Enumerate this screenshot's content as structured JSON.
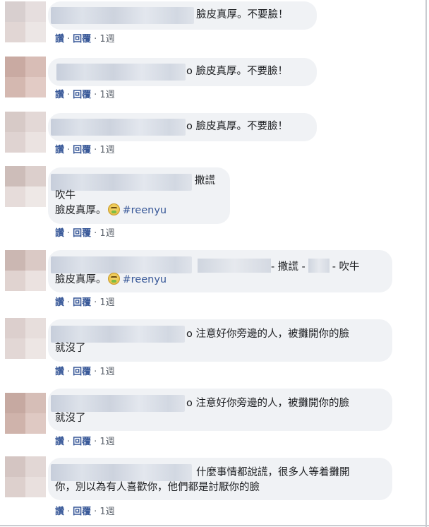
{
  "actions": {
    "like": "讚",
    "reply": "回覆",
    "separator": "·",
    "time": "1週"
  },
  "comments": [
    {
      "lines": [
        "臉皮真厚。不要臉！"
      ]
    },
    {
      "lines": [
        "o 臉皮真厚。不要臉！"
      ]
    },
    {
      "lines": [
        "o 臉皮真厚。不要臉！"
      ]
    },
    {
      "lines": [
        "撒謊",
        "吹牛",
        "臉皮真厚。"
      ],
      "hashtag": "#reenyu"
    },
    {
      "lines": [
        "- 撒謊 -",
        "- 吹牛",
        "臉皮真厚。"
      ],
      "hashtag": "#reenyu"
    },
    {
      "lines": [
        "o 注意好你旁邊的人，被攤開你的臉",
        "就沒了"
      ]
    },
    {
      "lines": [
        "o 注意好你旁邊的人，被攤開你的臉",
        "就沒了"
      ]
    },
    {
      "lines": [
        "什麼事情都說謊，很多人等着攤開",
        "你，別以為有人喜歡你，他們都是討厭你的臉"
      ]
    }
  ]
}
